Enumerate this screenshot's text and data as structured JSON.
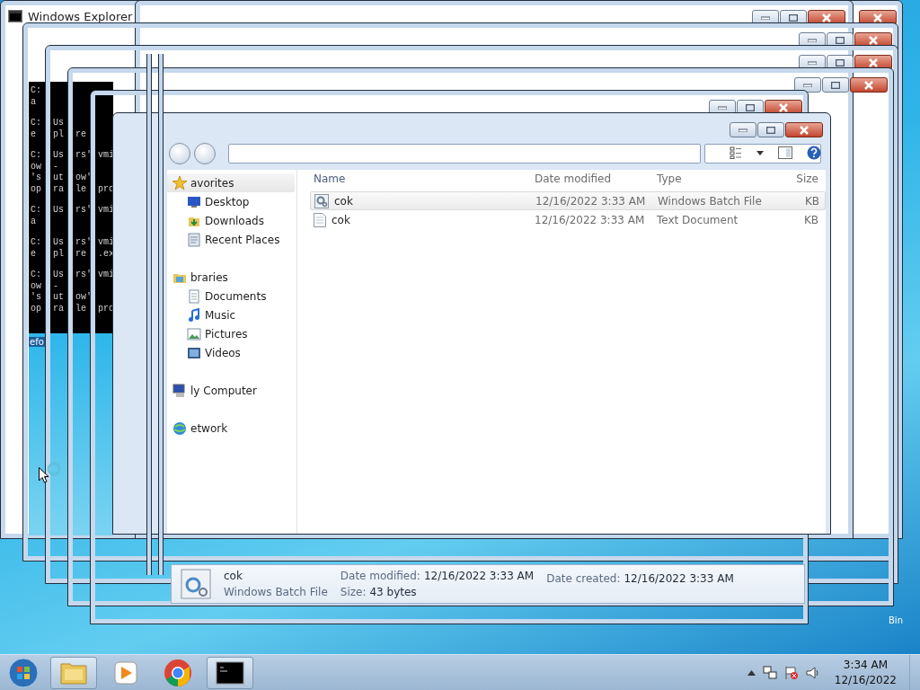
{
  "background_window": {
    "title": "Windows Explorer",
    "console": [
      [
        [
          "C:"
        ],
        [
          "a"
        ]
      ],
      [
        [
          "C:",
          "Us"
        ],
        [
          "e",
          "pl",
          "re"
        ]
      ],
      [
        [
          "C:",
          "Us",
          "rs'",
          "vmi"
        ],
        [
          "ow",
          "-"
        ],
        [
          "'s",
          "ut",
          "ow'"
        ],
        [
          "op",
          "ra",
          "le",
          "pro"
        ]
      ],
      [
        [
          "C:",
          "Us",
          "rs'",
          "vmi"
        ],
        [
          "a"
        ]
      ],
      [
        [
          "C:",
          "Us",
          "rs'",
          "vmi"
        ],
        [
          "e",
          "pl",
          "re",
          ".ex"
        ]
      ],
      [
        [
          "C:",
          "Us",
          "rs'",
          "vmi"
        ],
        [
          "ow",
          "-"
        ],
        [
          "'s",
          "ut",
          "ow'"
        ],
        [
          "op",
          "ra",
          "le",
          "pro"
        ]
      ]
    ],
    "desktop_label": "efo"
  },
  "explorer": {
    "nav": [
      {
        "label": "avorites",
        "kind": "favorites",
        "selected": true,
        "children": [
          {
            "label": "Desktop",
            "kind": "desktop",
            "selected": false
          },
          {
            "label": "Downloads",
            "kind": "downloads",
            "selected": false
          },
          {
            "label": "Recent Places",
            "kind": "recent",
            "selected": false
          }
        ]
      },
      {
        "label": "braries",
        "kind": "libraries",
        "selected": false,
        "children": [
          {
            "label": "Documents",
            "kind": "documents",
            "selected": false
          },
          {
            "label": "Music",
            "kind": "music",
            "selected": false
          },
          {
            "label": "Pictures",
            "kind": "pictures",
            "selected": false
          },
          {
            "label": "Videos",
            "kind": "videos",
            "selected": false
          }
        ]
      },
      {
        "label": "ly Computer",
        "kind": "computer",
        "selected": false
      },
      {
        "label": "etwork",
        "kind": "network",
        "selected": false
      }
    ],
    "columns": [
      "Name",
      "Date modified",
      "Type",
      "Size"
    ],
    "files": [
      {
        "kind": "batch",
        "name": "cok",
        "date": "12/16/2022 3:33 AM",
        "type": "Windows Batch File",
        "size": "KB",
        "selected": true
      },
      {
        "kind": "text",
        "name": "cok",
        "date": "12/16/2022 3:33 AM",
        "type": "Text Document",
        "size": "KB",
        "selected": false
      }
    ],
    "details": {
      "kind": "batch",
      "name": "cok",
      "modified_label": "Date modified:",
      "modified": "12/16/2022 3:33 AM",
      "created_label": "Date created:",
      "created": "12/16/2022 3:33 AM",
      "type": "Windows Batch File",
      "size_label": "Size:",
      "size": "43 bytes"
    }
  },
  "desktop_label": "Bin",
  "taskbar": {
    "apps": [
      {
        "kind": "explorer",
        "running": true
      },
      {
        "kind": "media",
        "running": false
      },
      {
        "kind": "chrome",
        "running": false
      },
      {
        "kind": "console",
        "running": true
      }
    ],
    "clock": {
      "time": "3:34 AM",
      "date": "12/16/2022"
    }
  }
}
